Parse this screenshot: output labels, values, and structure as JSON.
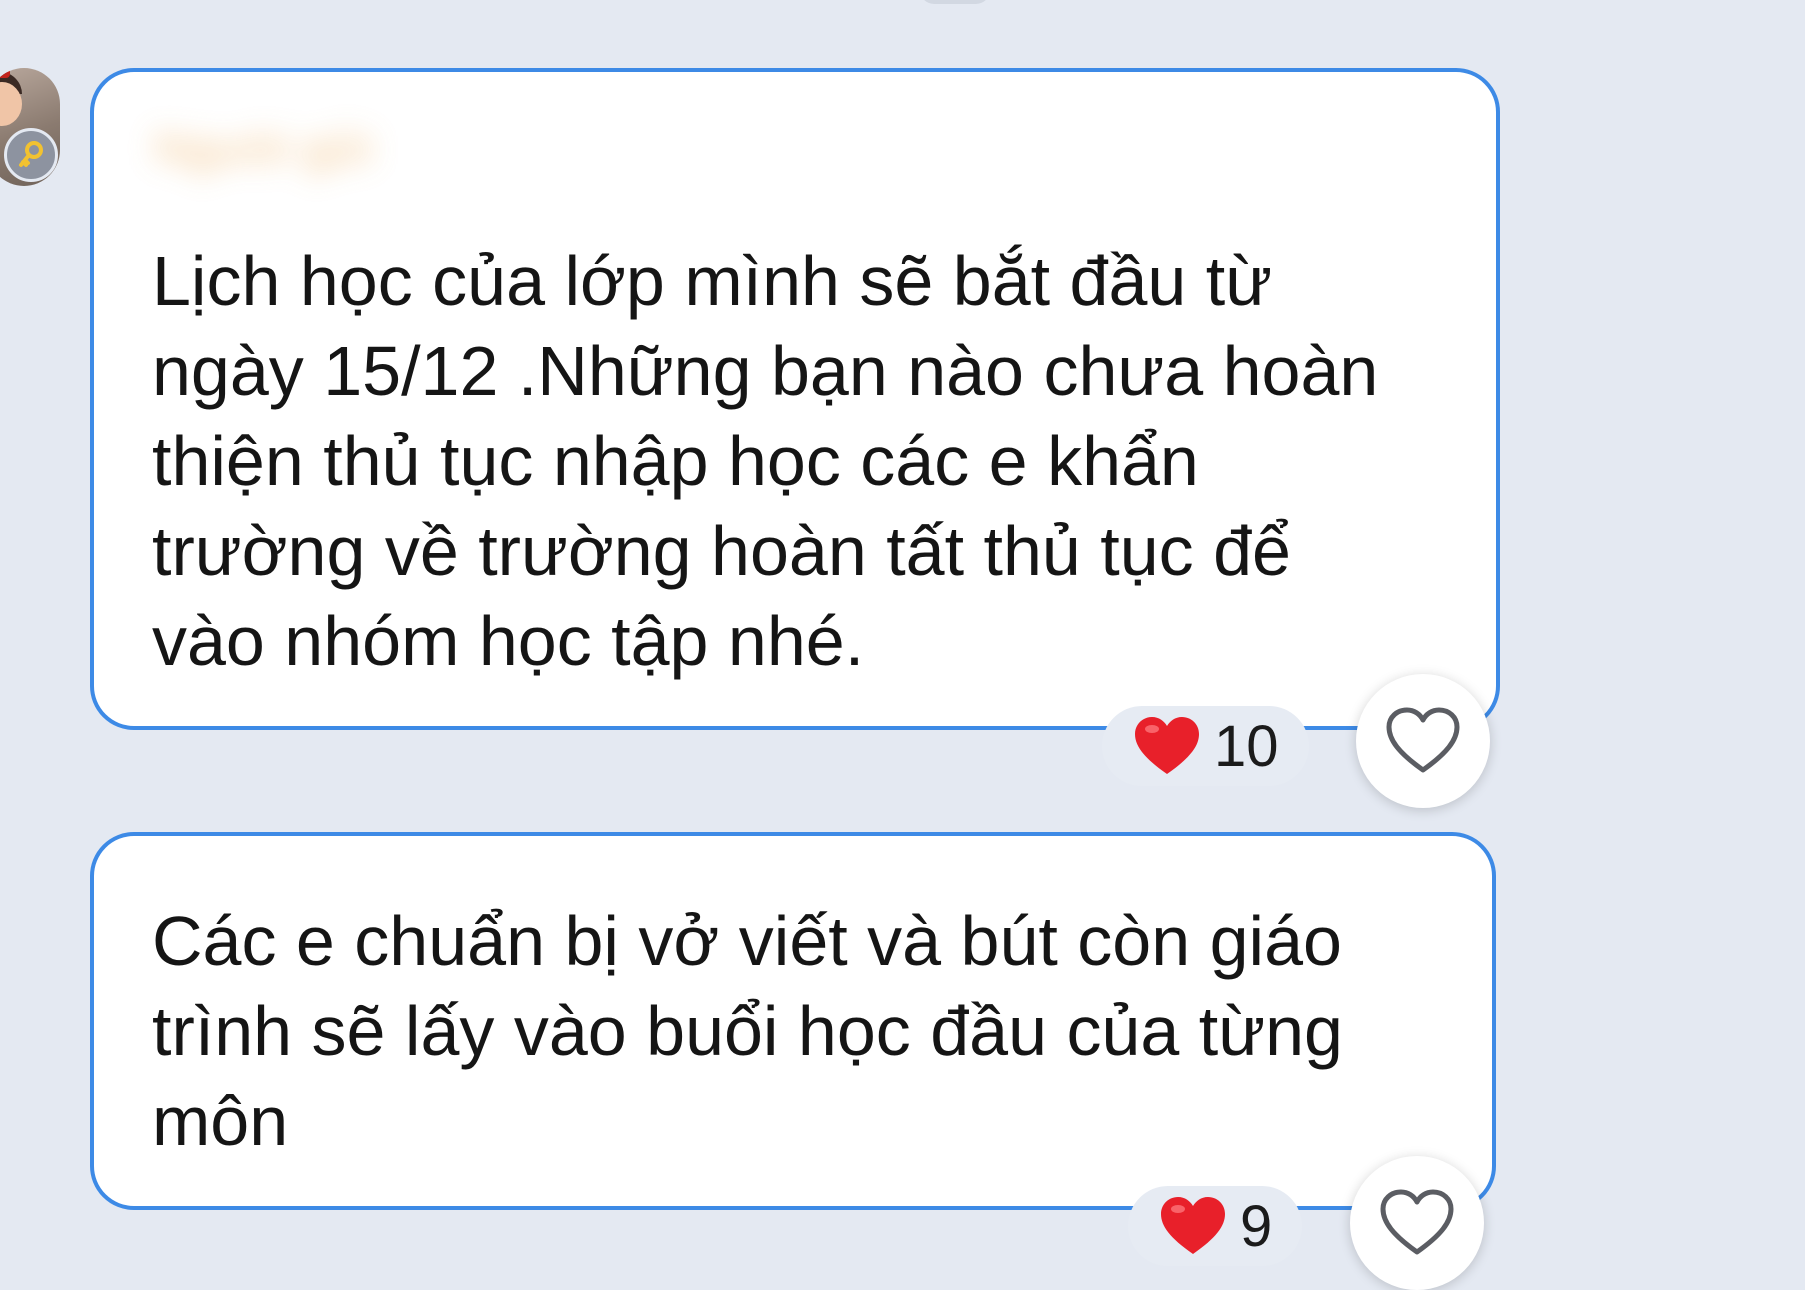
{
  "conversation": {
    "top_indicator_icon": "scroll-nub",
    "avatar": {
      "icon": "user-avatar",
      "badge_icon": "key-icon"
    },
    "messages": [
      {
        "sender_name_blurred": "Người gửi",
        "text": "Lịch học của lớp mình sẽ bắt đầu từ\nngày 15/12 .Những bạn nào chưa hoàn\nthiện thủ tục nhập học các e khẩn\ntrường về trường hoàn tất thủ tục để\nvào nhóm học tập nhé.",
        "reaction": {
          "icon": "red-heart-icon",
          "count": "10"
        },
        "like_icon": "heart-outline-icon"
      },
      {
        "text": "Các e chuẩn bị vở viết và bút còn giáo\ntrình sẽ lấy vào buổi học đầu của từng\nmôn",
        "reaction": {
          "icon": "red-heart-icon",
          "count": "9"
        },
        "like_icon": "heart-outline-icon"
      }
    ]
  },
  "colors": {
    "background": "#e4e9f2",
    "bubble_border": "#3d8ae6",
    "bubble_fill": "#ffffff",
    "reaction_heart": "#e8202a",
    "text": "#151515"
  }
}
